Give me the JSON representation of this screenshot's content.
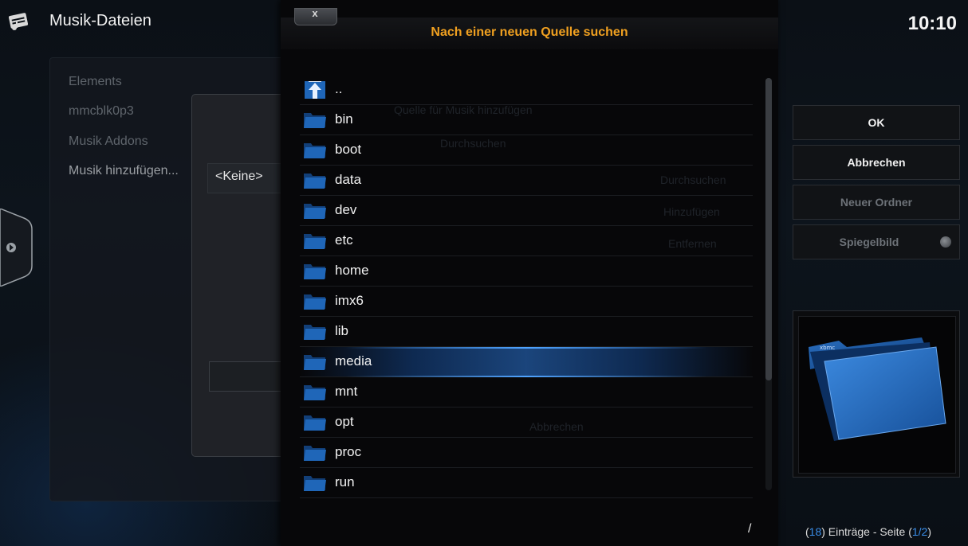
{
  "window": {
    "title": "Musik-Dateien",
    "clock": "10:10"
  },
  "background": {
    "items": [
      "Elements",
      "mmcblk0p3",
      "Musik Addons",
      "Musik hinzufügen..."
    ],
    "behind_dialog": {
      "title": "Quelle für Musik hinzufügen",
      "subtitle": "Durchsuchen",
      "buttons": [
        "Durchsuchen",
        "Hinzufügen",
        "Entfernen"
      ],
      "cancel": "Abbrechen"
    },
    "selected_source": "<Keine>"
  },
  "dialog": {
    "title": "Nach einer neuen Quelle suchen",
    "close_label": "x",
    "focused_item": "media",
    "items": [
      {
        "label": "..",
        "icon": "parent-folder-icon"
      },
      {
        "label": "bin",
        "icon": "folder-icon"
      },
      {
        "label": "boot",
        "icon": "folder-icon"
      },
      {
        "label": "data",
        "icon": "folder-icon"
      },
      {
        "label": "dev",
        "icon": "folder-icon"
      },
      {
        "label": "etc",
        "icon": "folder-icon"
      },
      {
        "label": "home",
        "icon": "folder-icon"
      },
      {
        "label": "imx6",
        "icon": "folder-icon"
      },
      {
        "label": "lib",
        "icon": "folder-icon"
      },
      {
        "label": "media",
        "icon": "folder-icon"
      },
      {
        "label": "mnt",
        "icon": "folder-icon"
      },
      {
        "label": "opt",
        "icon": "folder-icon"
      },
      {
        "label": "proc",
        "icon": "folder-icon"
      },
      {
        "label": "run",
        "icon": "folder-icon"
      }
    ],
    "current_path": "/"
  },
  "buttons": {
    "ok": "OK",
    "cancel": "Abbrechen",
    "new_folder": "Neuer Ordner",
    "mirror": "Spiegelbild"
  },
  "status": {
    "open": "(",
    "count": "18",
    "text": ") Einträge - Seite (",
    "page": "1/2",
    "close": ")"
  },
  "colors": {
    "accent": "#3a8eea",
    "title": "#f0a020",
    "folder": "#1f66b8"
  }
}
